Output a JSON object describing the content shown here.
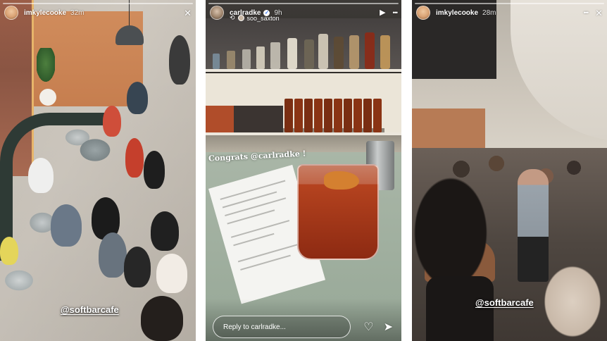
{
  "stories": [
    {
      "username": "imkylecooke",
      "timestamp": "32m",
      "tag": "@softbarcafe",
      "close_icon": "close-icon"
    },
    {
      "username": "carlradke",
      "verified_mark": "✓",
      "timestamp": "9h",
      "music_user": "soo_saxton",
      "caption": "Congrats @carlradke !",
      "reply_placeholder": "Reply to carlradke...",
      "icons": [
        "play-icon",
        "more-icon",
        "heart-icon",
        "send-icon"
      ]
    },
    {
      "username": "imkylecooke",
      "timestamp": "28m",
      "tag": "@softbarcafe",
      "icons": [
        "more-icon",
        "close-icon"
      ]
    }
  ],
  "glyphs": {
    "close": "✕",
    "more": "•••",
    "play": "▶",
    "heart": "♡",
    "send": "➤",
    "repost": "⟲"
  },
  "colors": {
    "verified_blue": "#2b6ef6",
    "overlay_text": "#ffffff"
  }
}
